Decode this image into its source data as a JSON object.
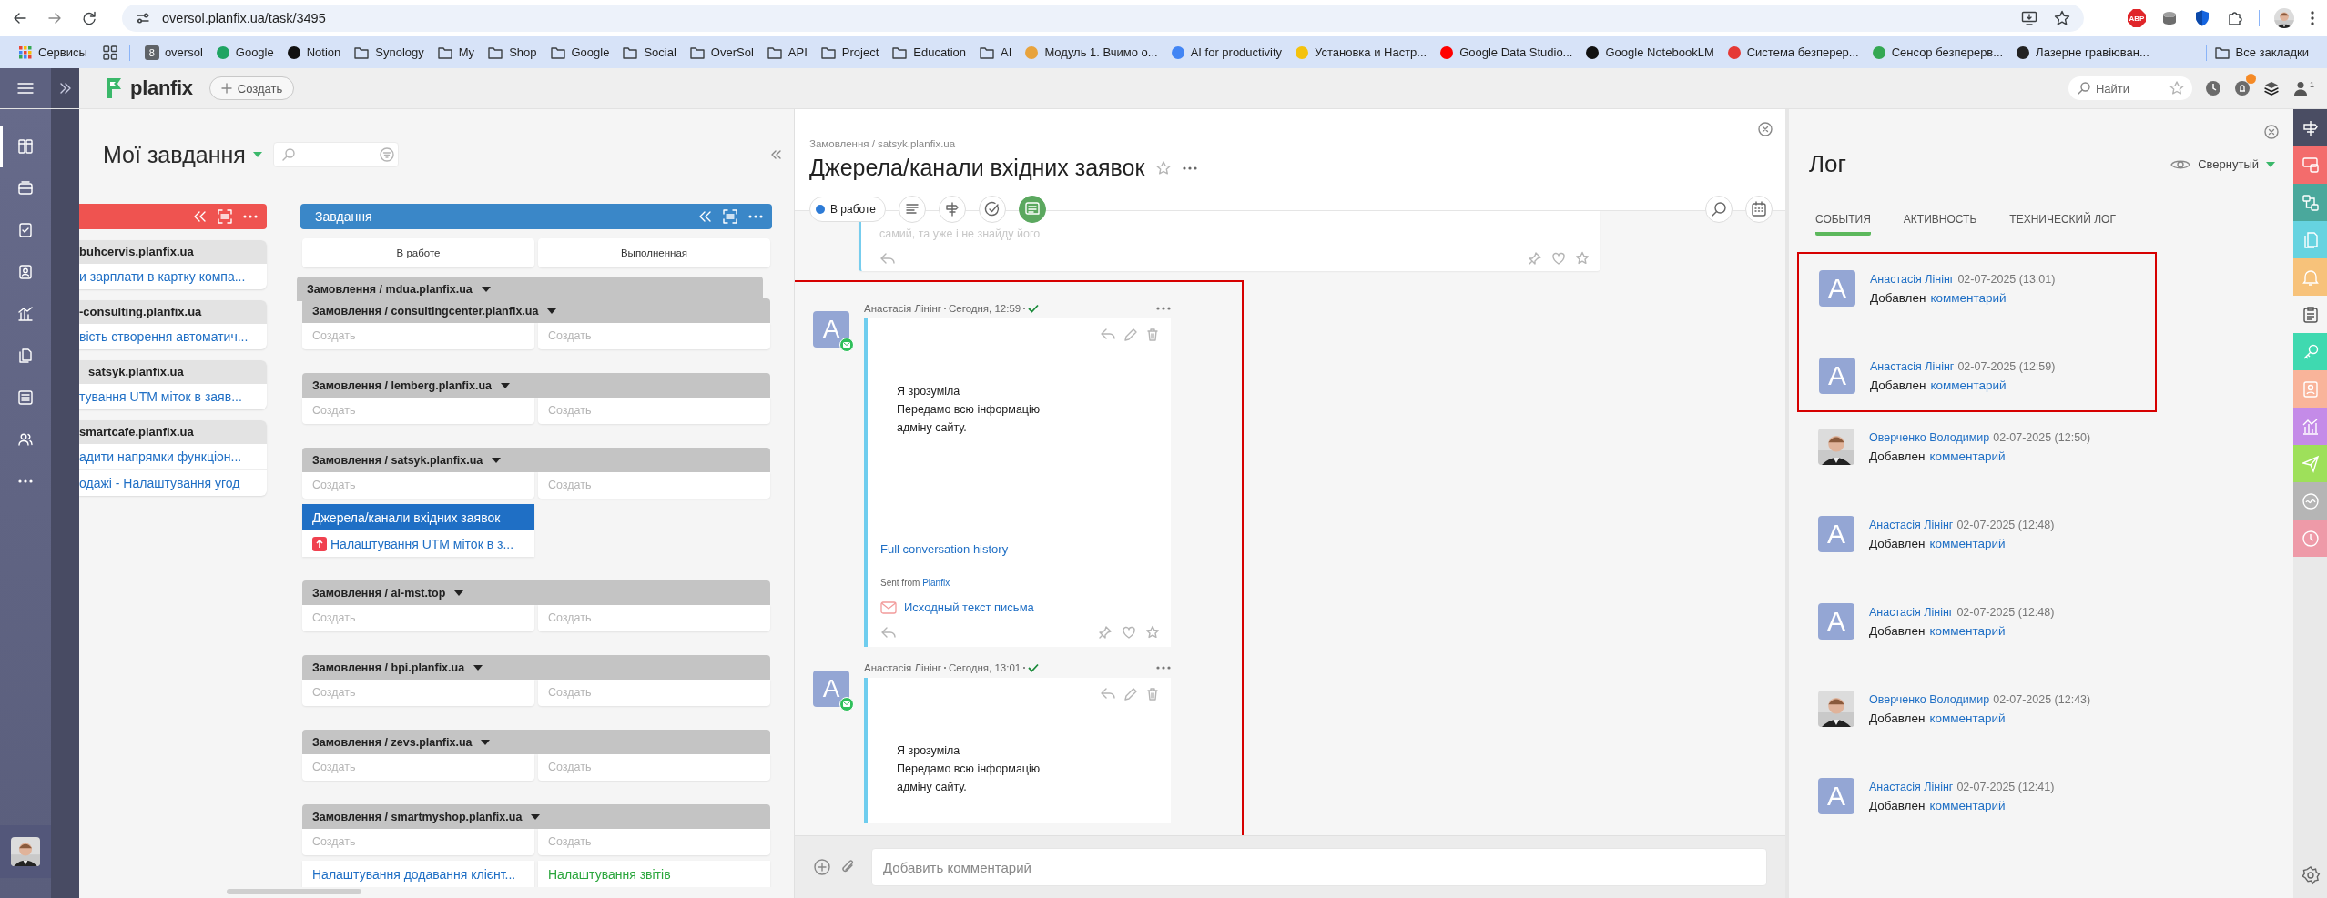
{
  "browser": {
    "url": "oversol.planfix.ua/task/3495",
    "bookmarks": [
      {
        "kind": "apps",
        "label": "Сервисы"
      },
      {
        "kind": "grid"
      },
      {
        "kind": "site",
        "label": "oversol",
        "color": "#5f6368",
        "icon_text": "8"
      },
      {
        "kind": "site",
        "label": "Google",
        "color": "#1fa463"
      },
      {
        "kind": "site",
        "label": "Notion",
        "color": "#111111"
      },
      {
        "kind": "folder",
        "label": "Synology"
      },
      {
        "kind": "folder",
        "label": "My"
      },
      {
        "kind": "folder",
        "label": "Shop"
      },
      {
        "kind": "folder",
        "label": "Google"
      },
      {
        "kind": "folder",
        "label": "Social"
      },
      {
        "kind": "folder",
        "label": "OverSol"
      },
      {
        "kind": "folder",
        "label": "API"
      },
      {
        "kind": "folder",
        "label": "Project"
      },
      {
        "kind": "folder",
        "label": "Education"
      },
      {
        "kind": "folder",
        "label": "AI"
      },
      {
        "kind": "site",
        "label": "Модуль 1. Вчимо о...",
        "color": "#e8a33d"
      },
      {
        "kind": "site",
        "label": "AI for productivity",
        "color": "#4285f4"
      },
      {
        "kind": "site",
        "label": "Установка и Настр...",
        "color": "#f4c20d"
      },
      {
        "kind": "site",
        "label": "Google Data Studio...",
        "color": "#ff0000"
      },
      {
        "kind": "site",
        "label": "Google NotebookLM",
        "color": "#111111"
      },
      {
        "kind": "site",
        "label": "Система безперер...",
        "color": "#e53935"
      },
      {
        "kind": "site",
        "label": "Сенсор безперерв...",
        "color": "#34a853"
      },
      {
        "kind": "site",
        "label": "Лазерне гравіюван...",
        "color": "#222222"
      }
    ],
    "all_bookmarks": "Все закладки",
    "extensions": [
      {
        "kind": "stop",
        "label": "ABP"
      },
      {
        "kind": "disk"
      },
      {
        "kind": "shield"
      },
      {
        "kind": "puzzle"
      }
    ]
  },
  "app_bar": {
    "logo": "planfix",
    "create": "Создать",
    "search_placeholder": "Найти",
    "profile_count": "1",
    "notification": true
  },
  "nav": {
    "items": [
      {
        "selected": true
      },
      {
        "selected": false
      },
      {
        "selected": false
      },
      {
        "selected": false
      },
      {
        "selected": false
      },
      {
        "selected": false
      },
      {
        "selected": false
      },
      {
        "selected": false
      },
      {
        "selected": false
      }
    ]
  },
  "task_list": {
    "title": "Мої завдання",
    "partial_column": {
      "color": "#ef5350",
      "cards": [
        {
          "group": "buhcervis.planfix.ua",
          "tasks": [
            "и зарплати в картку компа..."
          ]
        },
        {
          "group": "-consulting.planfix.ua",
          "tasks": [
            "вість створення автоматич..."
          ]
        },
        {
          "group": "satsyk.planfix.ua",
          "tasks": [
            "тування UTM міток в заяв..."
          ]
        },
        {
          "group": "smartcafe.planfix.ua",
          "tasks": [
            "адити напрямки функціон...",
            "одажі - Налаштування угод"
          ]
        }
      ]
    },
    "column": {
      "title": "Завдання",
      "color": "#3a87c8",
      "subtabs": [
        "В работе",
        "Выполненная"
      ],
      "groups": [
        {
          "kind": "stacked",
          "name": "Замовлення / mdua.planfix.ua"
        },
        {
          "kind": "group",
          "name": "Замовлення / consultingcenter.planfix.ua",
          "create": [
            "Создать",
            "Создать"
          ]
        },
        {
          "kind": "group",
          "name": "Замовлення / lemberg.planfix.ua",
          "create": [
            "Создать",
            "Создать"
          ]
        },
        {
          "kind": "group",
          "name": "Замовлення / satsyk.planfix.ua",
          "create": [
            "Создать",
            "Создать"
          ],
          "tasks": [
            {
              "title": "Джерела/канали вхідних заявок",
              "done": false,
              "selected": true,
              "urgent": false,
              "color": "#1f6fc5"
            },
            {
              "title": "Налаштування UTM міток в з...",
              "done": false,
              "selected": false,
              "urgent": true,
              "color": "#1f6fc5"
            }
          ]
        },
        {
          "kind": "group",
          "name": "Замовлення / ai-mst.top",
          "create": [
            "Создать",
            "Создать"
          ]
        },
        {
          "kind": "group",
          "name": "Замовлення / bpi.planfix.ua",
          "create": [
            "Создать",
            "Создать"
          ]
        },
        {
          "kind": "group",
          "name": "Замовлення / zevs.planfix.ua",
          "create": [
            "Создать",
            "Создать"
          ]
        },
        {
          "kind": "group",
          "name": "Замовлення / smartmyshop.planfix.ua",
          "create": [
            "Создать",
            "Создать"
          ],
          "tasks": [
            {
              "title": "Налаштування додавання клієнт...",
              "done": false,
              "selected": false,
              "urgent": false,
              "color": "#1f6fc5"
            },
            {
              "title": "Налаштування звітів",
              "done": true,
              "selected": false,
              "urgent": false,
              "color": "#2aa63c"
            }
          ]
        }
      ]
    }
  },
  "task": {
    "breadcrumb": "Замовлення / satsyk.planfix.ua",
    "title": "Джерела/канали вхідних заявок",
    "status": {
      "label": "В работе",
      "color": "#2d7bd6"
    },
    "tools": [
      {
        "selected": false
      },
      {
        "selected": false
      },
      {
        "selected": false
      },
      {
        "selected": true
      }
    ],
    "previous_comment_tail": "самий, та уже і не знайду його",
    "comments": [
      {
        "author": "Анастасія Лінінг",
        "time": "Сегодня, 12:59",
        "initial": "A",
        "read": true,
        "highlighted": true,
        "text": "Я зрозуміла\nПередамо всю інформацію\nадміну сайту.",
        "history_link": "Full conversation history",
        "sent_from": "Sent from",
        "sent_from_link": "Planfix",
        "source_link": "Исходный текст письма"
      },
      {
        "author": "Анастасія Лінінг",
        "time": "Сегодня, 13:01",
        "initial": "A",
        "read": true,
        "highlighted": true,
        "text": "Я зрозуміла\nПередамо всю інформацію\nадміну сайту."
      }
    ],
    "composer_placeholder": "Добавить комментарий"
  },
  "log": {
    "title": "Лог",
    "view": "Свернутый",
    "tabs": [
      {
        "label": "СОБЫТИЯ",
        "selected": true
      },
      {
        "label": "АКТИВНОСТЬ",
        "selected": false
      },
      {
        "label": "ТЕХНИЧЕСКИЙ ЛОГ",
        "selected": false
      }
    ],
    "entries": [
      {
        "author": "Анастасія Лінінг",
        "date": "02-07-2025 (13:01)",
        "action": "Добавлен",
        "object": "комментарий",
        "avatar": {
          "kind": "letter",
          "initial": "A"
        },
        "highlighted": true
      },
      {
        "author": "Анастасія Лінінг",
        "date": "02-07-2025 (12:59)",
        "action": "Добавлен",
        "object": "комментарий",
        "avatar": {
          "kind": "letter",
          "initial": "A"
        },
        "highlighted": true
      },
      {
        "author": "Оверченко Володимир",
        "date": "02-07-2025 (12:50)",
        "action": "Добавлен",
        "object": "комментарий",
        "highlighted": false
      },
      {
        "author": "Анастасія Лінінг",
        "date": "02-07-2025 (12:48)",
        "action": "Добавлен",
        "object": "комментарий",
        "avatar": {
          "kind": "letter",
          "initial": "A"
        },
        "highlighted": false
      },
      {
        "author": "Анастасія Лінінг",
        "date": "02-07-2025 (12:48)",
        "action": "Добавлен",
        "object": "комментарий",
        "avatar": {
          "kind": "letter",
          "initial": "A"
        },
        "highlighted": false
      },
      {
        "author": "Оверченко Володимир",
        "date": "02-07-2025 (12:43)",
        "action": "Добавлен",
        "object": "комментарий",
        "highlighted": false
      },
      {
        "author": "Анастасія Лінінг",
        "date": "02-07-2025 (12:41)",
        "action": "Добавлен",
        "object": "комментарий",
        "avatar": {
          "kind": "letter",
          "initial": "A"
        },
        "highlighted": false
      }
    ]
  },
  "rail": {
    "items": [
      {
        "color": "#4a4d63"
      },
      {
        "color": "#f36c6c"
      },
      {
        "color": "#4aa89c"
      },
      {
        "color": "#66d3e0"
      },
      {
        "color": "#f7c27a"
      },
      {
        "color": "#f5f5f5"
      },
      {
        "color": "#3fd9b0"
      },
      {
        "color": "#f9b49a"
      },
      {
        "color": "#c48be8"
      },
      {
        "color": "#9ee05a"
      },
      {
        "color": "#b5b5b5"
      },
      {
        "color": "#ee9aa8"
      }
    ]
  }
}
